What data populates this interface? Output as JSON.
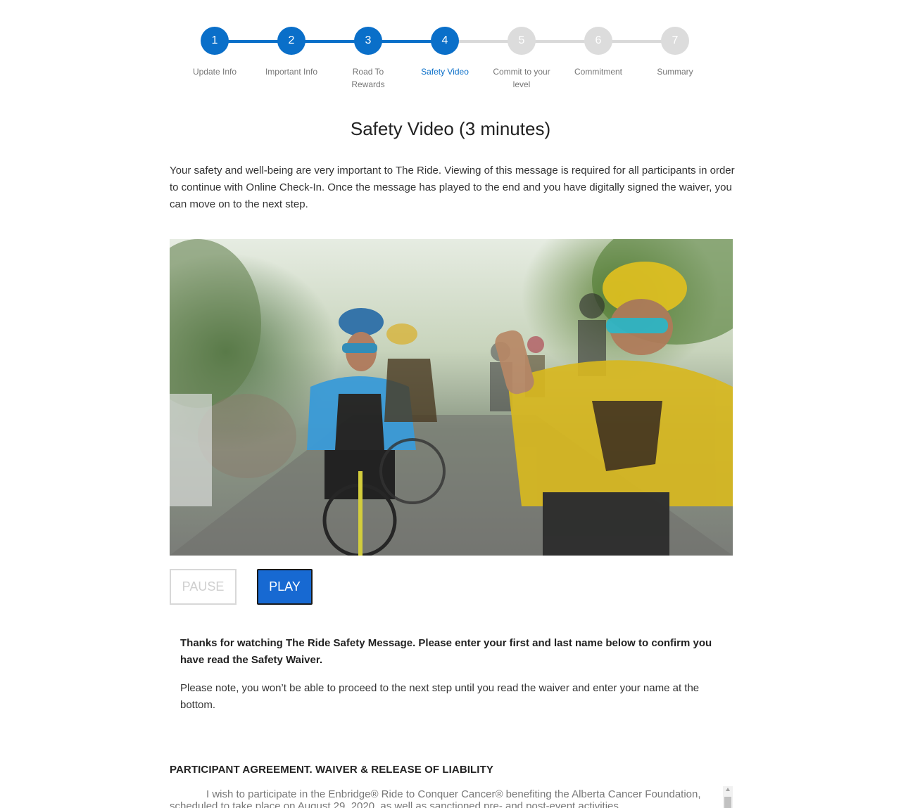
{
  "stepper": {
    "steps": [
      {
        "number": "1",
        "label": "Update Info",
        "state": "done"
      },
      {
        "number": "2",
        "label": "Important Info",
        "state": "done"
      },
      {
        "number": "3",
        "label": "Road To Rewards",
        "state": "done"
      },
      {
        "number": "4",
        "label": "Safety Video",
        "state": "current"
      },
      {
        "number": "5",
        "label": "Commit to your level",
        "state": "todo"
      },
      {
        "number": "6",
        "label": "Commitment",
        "state": "todo"
      },
      {
        "number": "7",
        "label": "Summary",
        "state": "todo"
      }
    ],
    "colors": {
      "active": "#0a6fc9",
      "inactive": "#dcdcdc"
    }
  },
  "main": {
    "title": "Safety Video (3 minutes)",
    "intro": "Your safety and well-being are very important to The Ride. Viewing of this message is required for all participants in order to continue with Online Check-In. Once the message has played to the end and you have digitally signed the waiver, you can move on to the next step."
  },
  "video": {
    "pause_label": "PAUSE",
    "play_label": "PLAY",
    "accent_color": "#1769d2"
  },
  "confirmation": {
    "thanks": "Thanks for watching The Ride Safety Message. Please enter your first and last name below to confirm you have read the Safety Waiver.",
    "note": "Please note, you won’t be able to proceed to the next step until you read the waiver and enter your name at the bottom."
  },
  "waiver": {
    "heading": "PARTICIPANT AGREEMENT. WAIVER & RELEASE OF LIABILITY",
    "text": "I wish to participate in the Enbridge® Ride to Conquer Cancer® benefiting the Alberta Cancer Foundation, scheduled to take place on August 29, 2020, as well as sanctioned pre- and post-event activities"
  }
}
